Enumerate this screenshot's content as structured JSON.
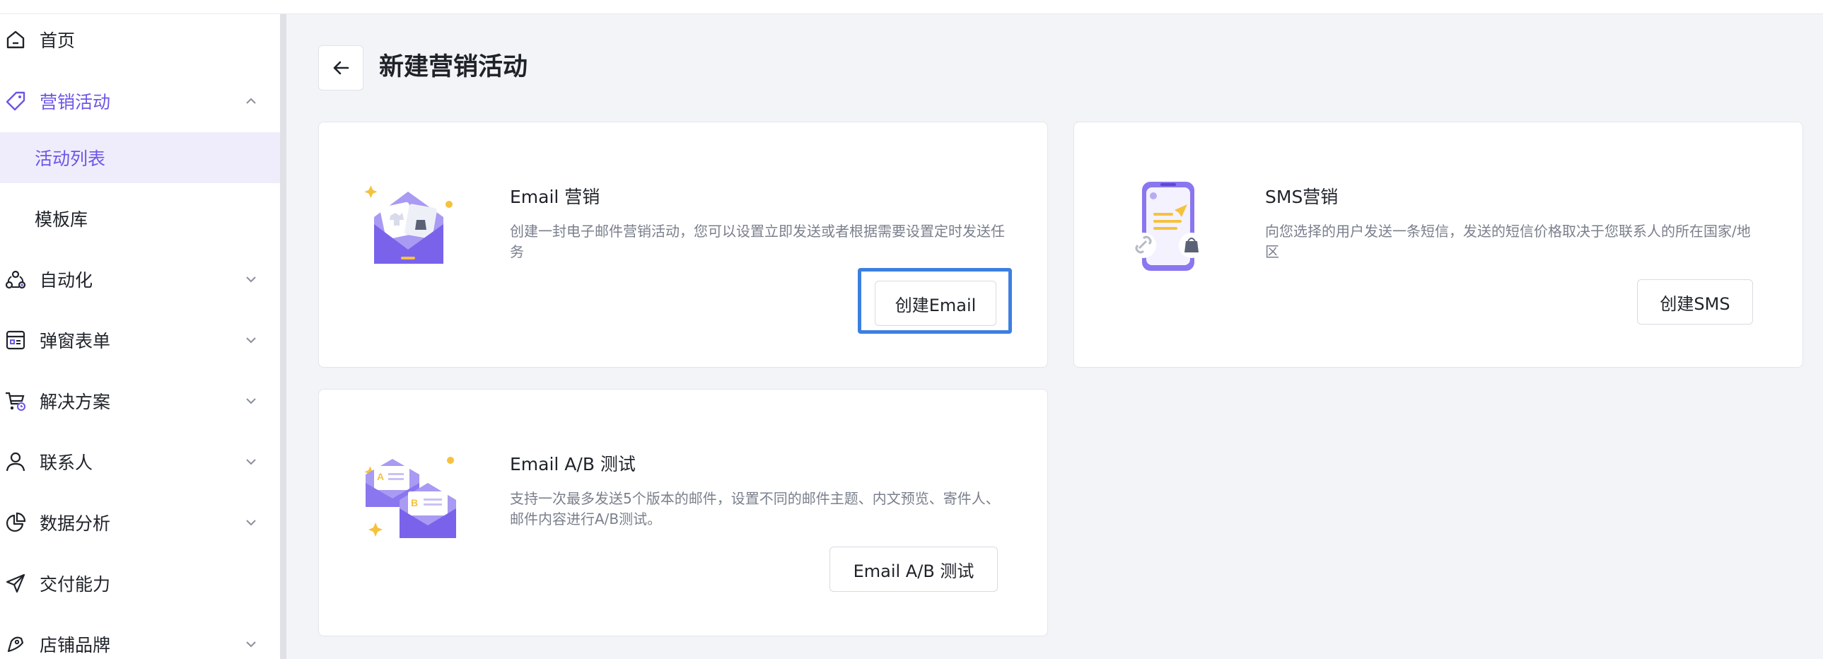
{
  "sidebar": {
    "items": [
      {
        "label": "首页",
        "icon": "home-icon"
      },
      {
        "label": "营销活动",
        "icon": "tag-icon",
        "expanded": true
      },
      {
        "label": "自动化",
        "icon": "automation-icon"
      },
      {
        "label": "弹窗表单",
        "icon": "form-icon"
      },
      {
        "label": "解决方案",
        "icon": "cart-icon"
      },
      {
        "label": "联系人",
        "icon": "person-icon"
      },
      {
        "label": "数据分析",
        "icon": "pie-chart-icon"
      },
      {
        "label": "交付能力",
        "icon": "send-icon"
      },
      {
        "label": "店铺品牌",
        "icon": "brand-icon"
      }
    ],
    "sub_items": [
      {
        "label": "活动列表",
        "selected": true
      },
      {
        "label": "模板库",
        "selected": false
      }
    ]
  },
  "header": {
    "title": "新建营销活动"
  },
  "cards": {
    "email": {
      "title": "Email 营销",
      "desc": "创建一封电子邮件营销活动，您可以设置立即发送或者根据需要设置定时发送任务",
      "button": "创建Email"
    },
    "sms": {
      "title": "SMS营销",
      "desc": "向您选择的用户发送一条短信，发送的短信价格取决于您联系人的所在国家/地区",
      "button": "创建SMS"
    },
    "ab": {
      "title": "Email A/B 测试",
      "desc": "支持一次最多发送5个版本的邮件，设置不同的邮件主题、内文预览、寄件人、邮件内容进行A/B测试。",
      "button": "Email A/B 测试"
    }
  },
  "colors": {
    "accent": "#6b56e8",
    "highlight": "#3d7fe0"
  }
}
